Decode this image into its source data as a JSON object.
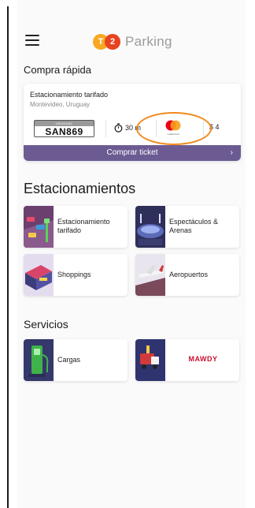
{
  "header": {
    "logo_c1": "T",
    "logo_c2": "2",
    "logo_text": "Parking"
  },
  "quick_buy": {
    "title": "Compra rápida",
    "card_title": "Estacionamiento tarifado",
    "card_subtitle": "Montevideo, Uruguay",
    "plate_country": "URUGUAY",
    "plate_number": "SAN869",
    "duration": "30 m",
    "card_brand": "mastercard",
    "price": "$ 4",
    "buy_label": "Comprar ticket",
    "buy_chevron": "›"
  },
  "parkings": {
    "title": "Estacionamientos",
    "items": [
      {
        "label": "Estacionamiento tarifado",
        "icon": "parking-meter-icon"
      },
      {
        "label": "Espectáculos & Arenas",
        "icon": "arena-icon"
      },
      {
        "label": "Shoppings",
        "icon": "shopping-icon"
      },
      {
        "label": "Aeropuertos",
        "icon": "airport-icon"
      }
    ]
  },
  "services": {
    "title": "Servicios",
    "items": [
      {
        "label": "Cargas",
        "icon": "charging-icon"
      },
      {
        "label": "MAWDY",
        "icon": "mawdy-icon"
      }
    ]
  },
  "colors": {
    "accent": "#6c5b93",
    "highlight": "#f08a1c",
    "logo_orange": "#f7a823",
    "logo_red": "#e8431f"
  }
}
